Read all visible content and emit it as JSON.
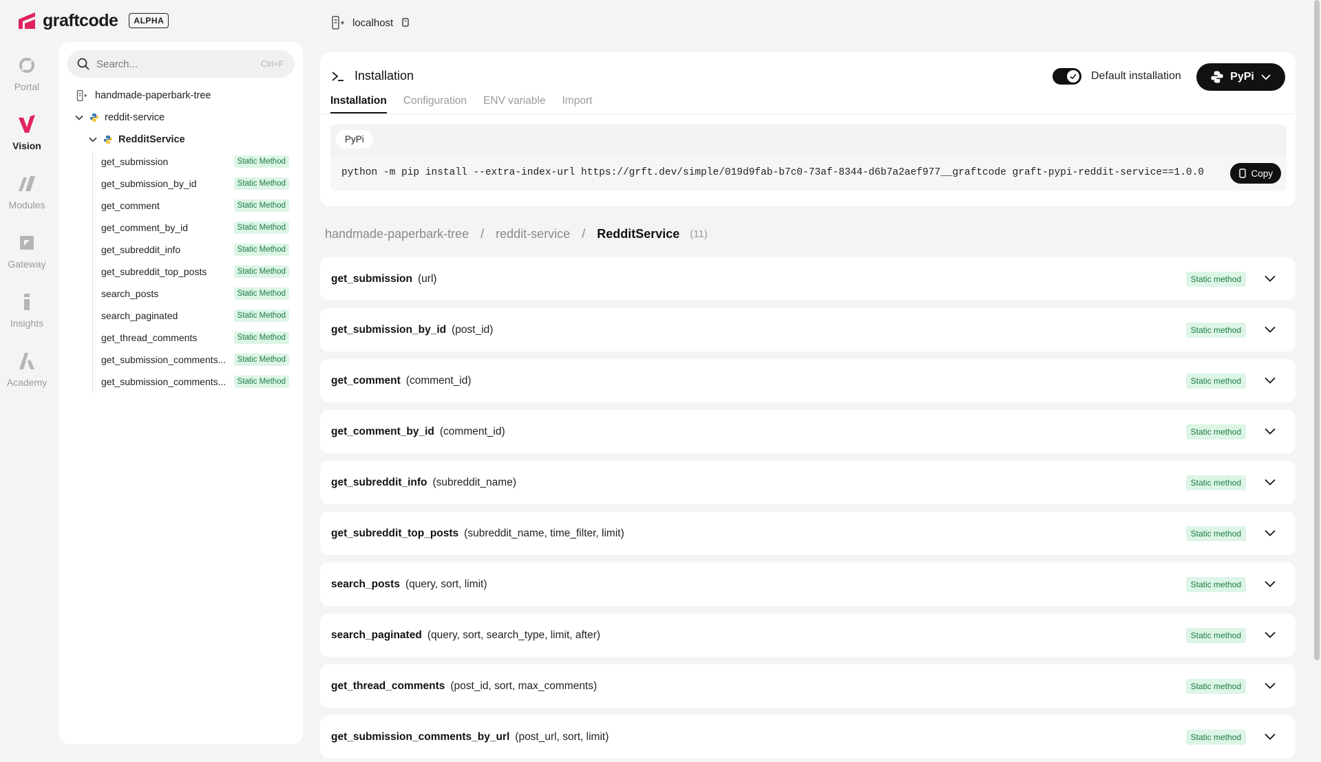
{
  "brand": {
    "name": "graftcode",
    "badge": "ALPHA"
  },
  "header": {
    "host": "localhost"
  },
  "rail": [
    {
      "label": "Portal",
      "icon": "portal-icon",
      "active": false
    },
    {
      "label": "Vision",
      "icon": "vision-icon",
      "active": true
    },
    {
      "label": "Modules",
      "icon": "modules-icon",
      "active": false
    },
    {
      "label": "Gateway",
      "icon": "gateway-icon",
      "active": false
    },
    {
      "label": "Insights",
      "icon": "insights-icon",
      "active": false
    },
    {
      "label": "Academy",
      "icon": "academy-icon",
      "active": false
    }
  ],
  "sidebar": {
    "search_placeholder": "Search...",
    "search_shortcut": "Ctrl+F",
    "tree_root": "handmade-paperbark-tree",
    "service": "reddit-service",
    "class_name": "RedditService",
    "methods": [
      {
        "name": "get_submission",
        "badge": "Static Method"
      },
      {
        "name": "get_submission_by_id",
        "badge": "Static Method"
      },
      {
        "name": "get_comment",
        "badge": "Static Method"
      },
      {
        "name": "get_comment_by_id",
        "badge": "Static Method"
      },
      {
        "name": "get_subreddit_info",
        "badge": "Static Method"
      },
      {
        "name": "get_subreddit_top_posts",
        "badge": "Static Method"
      },
      {
        "name": "search_posts",
        "badge": "Static Method"
      },
      {
        "name": "search_paginated",
        "badge": "Static Method"
      },
      {
        "name": "get_thread_comments",
        "badge": "Static Method"
      },
      {
        "name": "get_submission_comments...",
        "badge": "Static Method"
      },
      {
        "name": "get_submission_comments...",
        "badge": "Static Method"
      }
    ]
  },
  "installation": {
    "title": "Installation",
    "default_toggle_label": "Default installation",
    "default_toggle_on": true,
    "package_manager": "PyPi",
    "tabs": [
      "Installation",
      "Configuration",
      "ENV variable",
      "Import"
    ],
    "active_tab": "Installation",
    "code_tab": "PyPi",
    "command": "python -m pip install --extra-index-url https://grft.dev/simple/019d9fab-b7c0-73af-8344-d6b7a2aef977__graftcode graft-pypi-reddit-service==1.0.0",
    "copy_label": "Copy"
  },
  "breadcrumb": {
    "items": [
      "handmade-paperbark-tree",
      "reddit-service",
      "RedditService"
    ],
    "separator": "/",
    "count": "(11)"
  },
  "methods": [
    {
      "name": "get_submission",
      "params": "(url)",
      "badge": "Static method"
    },
    {
      "name": "get_submission_by_id",
      "params": "(post_id)",
      "badge": "Static method"
    },
    {
      "name": "get_comment",
      "params": "(comment_id)",
      "badge": "Static method"
    },
    {
      "name": "get_comment_by_id",
      "params": "(comment_id)",
      "badge": "Static method"
    },
    {
      "name": "get_subreddit_info",
      "params": "(subreddit_name)",
      "badge": "Static method"
    },
    {
      "name": "get_subreddit_top_posts",
      "params": "(subreddit_name, time_filter, limit)",
      "badge": "Static method"
    },
    {
      "name": "search_posts",
      "params": "(query, sort, limit)",
      "badge": "Static method"
    },
    {
      "name": "search_paginated",
      "params": "(query, sort, search_type, limit, after)",
      "badge": "Static method"
    },
    {
      "name": "get_thread_comments",
      "params": "(post_id, sort, max_comments)",
      "badge": "Static method"
    },
    {
      "name": "get_submission_comments_by_url",
      "params": "(post_url, sort, limit)",
      "badge": "Static method"
    }
  ],
  "colors": {
    "brand_accent": "#e0245e",
    "badge_bg": "#dcf5e6",
    "badge_text": "#1d7a45",
    "dark": "#111111",
    "page_bg": "#f4f4f5"
  }
}
